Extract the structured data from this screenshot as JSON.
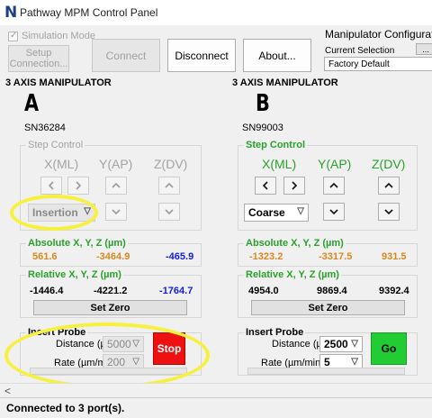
{
  "window": {
    "title": "Pathway MPM Control Panel",
    "logo_letter": "N"
  },
  "toolbar": {
    "simulation_label": "Simulation Mode",
    "setup_label": "Setup\nConnection...",
    "connect_label": "Connect",
    "disconnect_label": "Disconnect",
    "about_label": "About..."
  },
  "config": {
    "title": "Manipulator Configuratio",
    "current_selection_label": "Current Selection",
    "browse_label": "...",
    "selected_value": "Factory Default"
  },
  "panelA": {
    "header": "3 AXIS MANIPULATOR",
    "letter": "A",
    "serial": "SN36284",
    "step_control": "Step Control",
    "axes": [
      "X(ML)",
      "Y(AP)",
      "Z(DV)"
    ],
    "mode": "Insertion",
    "absolute_label": "Absolute X, Y, Z (µm)",
    "absolute": [
      "561.6",
      "-3464.9",
      "-465.9"
    ],
    "relative_label": "Relative X, Y, Z (µm)",
    "relative": [
      "-1446.4",
      "-4221.2",
      "-1764.7"
    ],
    "set_zero": "Set Zero",
    "insert_probe": "Insert Probe",
    "distance_label": "Distance (µm):",
    "distance_value": "5000",
    "rate_label": "Rate (µm/min):",
    "rate_value": "200",
    "action_label": "Stop",
    "action_color": "#ee1111"
  },
  "panelB": {
    "header": "3 AXIS MANIPULATOR",
    "letter": "B",
    "serial": "SN99003",
    "step_control": "Step Control",
    "axes": [
      "X(ML)",
      "Y(AP)",
      "Z(DV)"
    ],
    "mode": "Coarse",
    "absolute_label": "Absolute X, Y, Z (µm)",
    "absolute": [
      "-1323.2",
      "-3317.5",
      "931.5"
    ],
    "relative_label": "Relative X, Y, Z (µm)",
    "relative": [
      "4954.0",
      "9869.4",
      "9392.4"
    ],
    "set_zero": "Set Zero",
    "insert_probe": "Insert Probe",
    "distance_label": "Distance (µm):",
    "distance_value": "2500",
    "rate_label": "Rate (µm/min):",
    "rate_value": "5",
    "action_label": "Go",
    "action_color": "#22cc33"
  },
  "scrollbar": {
    "left_arrow": "<"
  },
  "status": {
    "text": "Connected to 3 port(s)."
  }
}
